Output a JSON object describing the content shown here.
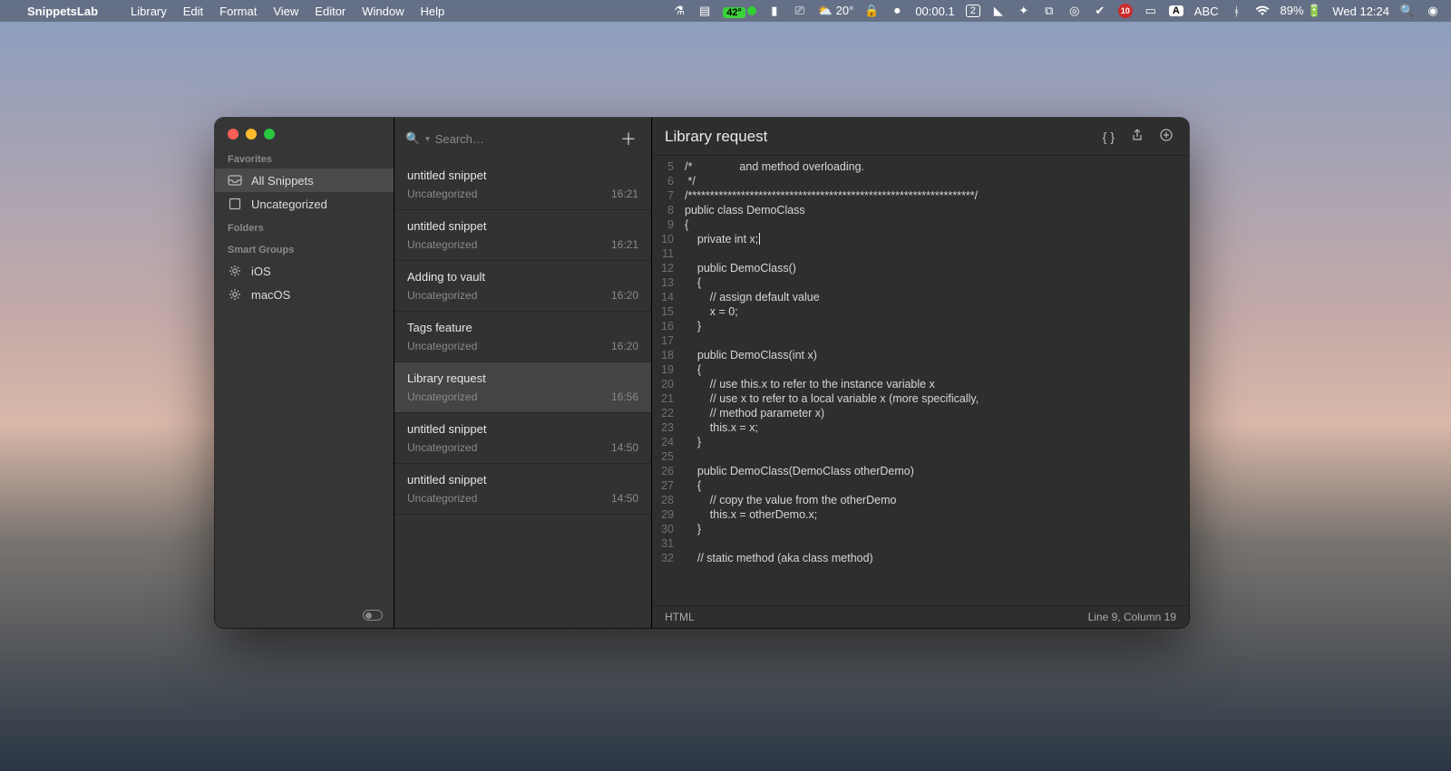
{
  "menubar": {
    "app_name": "SnippetsLab",
    "items": [
      "Library",
      "Edit",
      "Format",
      "View",
      "Editor",
      "Window",
      "Help"
    ],
    "temp_badge": "42°",
    "weather": "20°",
    "timer": "00:00.1",
    "workspace": "2",
    "notif_count": "10",
    "input_mode": "A",
    "kb_layout": "ABC",
    "battery": "89%",
    "clock": "Wed 12:24"
  },
  "sidebar": {
    "favorites_label": "Favorites",
    "folders_label": "Folders",
    "smart_label": "Smart Groups",
    "favorites": [
      {
        "label": "All Snippets",
        "active": true,
        "icon": "tray"
      },
      {
        "label": "Uncategorized",
        "active": false,
        "icon": "box"
      }
    ],
    "smart_groups": [
      {
        "label": "iOS"
      },
      {
        "label": "macOS"
      }
    ]
  },
  "list": {
    "search_placeholder": "Search…",
    "items": [
      {
        "title": "untitled snippet",
        "cat": "Uncategorized",
        "time": "16:21",
        "sel": false
      },
      {
        "title": "untitled snippet",
        "cat": "Uncategorized",
        "time": "16:21",
        "sel": false
      },
      {
        "title": "Adding to vault",
        "cat": "Uncategorized",
        "time": "16:20",
        "sel": false
      },
      {
        "title": "Tags feature",
        "cat": "Uncategorized",
        "time": "16:20",
        "sel": false
      },
      {
        "title": "Library request",
        "cat": "Uncategorized",
        "time": "16:56",
        "sel": true
      },
      {
        "title": "untitled snippet",
        "cat": "Uncategorized",
        "time": "14:50",
        "sel": false
      },
      {
        "title": "untitled snippet",
        "cat": "Uncategorized",
        "time": "14:50",
        "sel": false
      }
    ]
  },
  "editor": {
    "title": "Library request",
    "language": "HTML",
    "status": "Line 9, Column 19",
    "first_line_no": 5,
    "code_lines": [
      "/*               and method overloading.",
      " */",
      "/*****************************************************************/",
      "public class DemoClass",
      "{",
      "    private int x;",
      "",
      "    public DemoClass()",
      "    {",
      "        // assign default value",
      "        x = 0;",
      "    }",
      "",
      "    public DemoClass(int x)",
      "    {",
      "        // use this.x to refer to the instance variable x",
      "        // use x to refer to a local variable x (more specifically,",
      "        // method parameter x)",
      "        this.x = x;",
      "    }",
      "",
      "    public DemoClass(DemoClass otherDemo)",
      "    {",
      "        // copy the value from the otherDemo",
      "        this.x = otherDemo.x;",
      "    }",
      "",
      "    // static method (aka class method)"
    ],
    "cursor_line_index": 5
  }
}
